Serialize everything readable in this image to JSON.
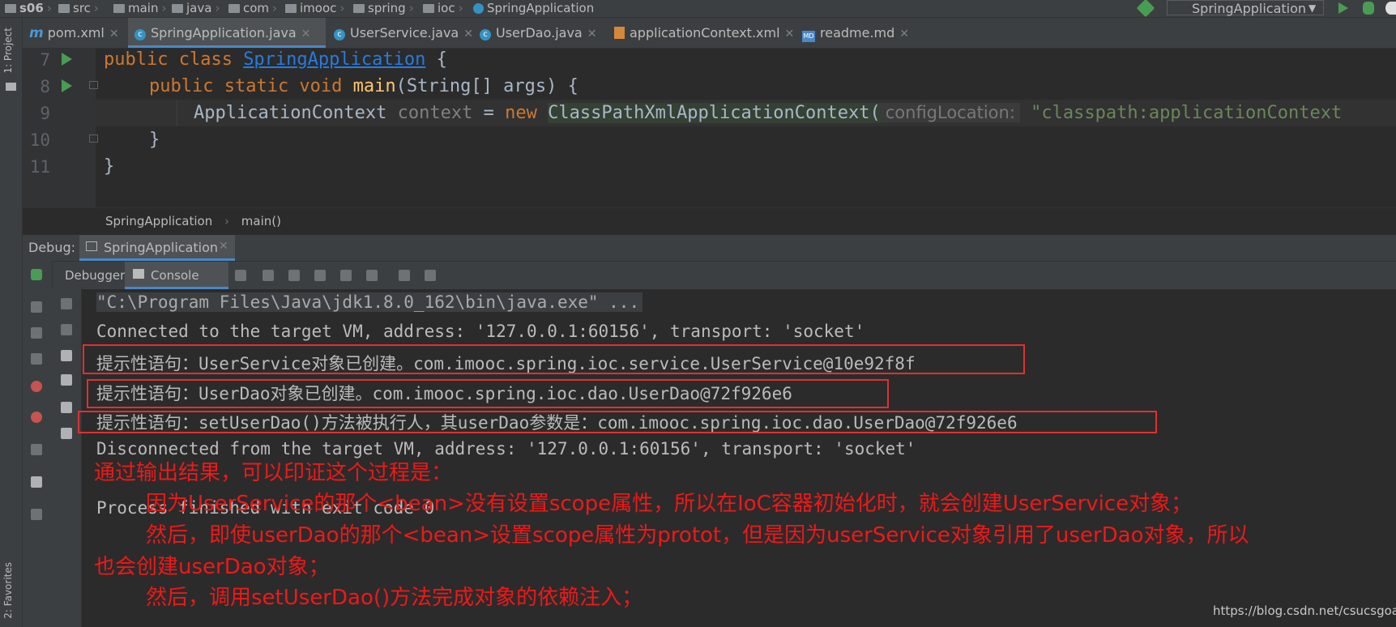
{
  "breadcrumb": {
    "items": [
      "s06",
      "src",
      "main",
      "java",
      "com",
      "imooc",
      "spring",
      "ioc",
      "SpringApplication"
    ]
  },
  "run_config": {
    "label": "SpringApplication"
  },
  "sidebar": {
    "project_label": "1: Project",
    "favorites_label": "2: Favorites"
  },
  "tabs": [
    {
      "label": "pom.xml",
      "icon": "maven-icon",
      "active": false
    },
    {
      "label": "SpringApplication.java",
      "icon": "class-icon",
      "active": true
    },
    {
      "label": "UserService.java",
      "icon": "class-icon",
      "active": false
    },
    {
      "label": "UserDao.java",
      "icon": "class-icon",
      "active": false
    },
    {
      "label": "applicationContext.xml",
      "icon": "xml-icon",
      "active": false
    },
    {
      "label": "readme.md",
      "icon": "markdown-icon",
      "active": false
    }
  ],
  "editor": {
    "lines": [
      {
        "num": "7"
      },
      {
        "num": "8"
      },
      {
        "num": "9"
      },
      {
        "num": "10"
      },
      {
        "num": "11"
      }
    ],
    "l7": {
      "kw": "public class ",
      "cls": "SpringApplication",
      "rest": " {"
    },
    "l8": {
      "kw": "public static void ",
      "method": "main",
      "rest": "(String[] args) {"
    },
    "l9": {
      "type": "ApplicationContext ",
      "var": "context",
      "eq": " = ",
      "kw": "new ",
      "ctor": "ClassPathXmlApplicationContext(",
      "hint": "configLocation:",
      "str": " \"classpath:applicationContext"
    },
    "l10": {
      "text": "}"
    },
    "l11": {
      "text": "}"
    },
    "footer": {
      "class_crumb": "SpringApplication",
      "method_crumb": "main()"
    }
  },
  "debug": {
    "title": "Debug:",
    "session_tab": "SpringApplication",
    "tabs": {
      "debugger": "Debugger",
      "console": "Console"
    }
  },
  "console": {
    "lines": [
      "\"C:\\Program Files\\Java\\jdk1.8.0_162\\bin\\java.exe\" ...",
      "Connected to the target VM, address: '127.0.0.1:60156', transport: 'socket'",
      "提示性语句：UserService对象已创建。com.imooc.spring.ioc.service.UserService@10e92f8f",
      "提示性语句：UserDao对象已创建。com.imooc.spring.ioc.dao.UserDao@72f926e6",
      "提示性语句：setUserDao()方法被执行人，其userDao参数是：com.imooc.spring.ioc.dao.UserDao@72f926e6",
      "Disconnected from the target VM, address: '127.0.0.1:60156', transport: 'socket'",
      "Process finished with exit code 0"
    ]
  },
  "annotation": {
    "lines": [
      "通过输出结果，可以印证这个过程是：",
      "因为UserService的那个<bean>没有设置scope属性，所以在IoC容器初始化时，就会创建UserService对象；",
      "然后，即使userDao的那个<bean>设置scope属性为protot，但是因为userService对象引用了userDao对象，所以",
      "也会创建userDao对象；",
      "然后，调用setUserDao()方法完成对象的依赖注入；"
    ],
    "color": "#f01818"
  },
  "watermark": "https://blog.csdn.net/csucsgoat"
}
